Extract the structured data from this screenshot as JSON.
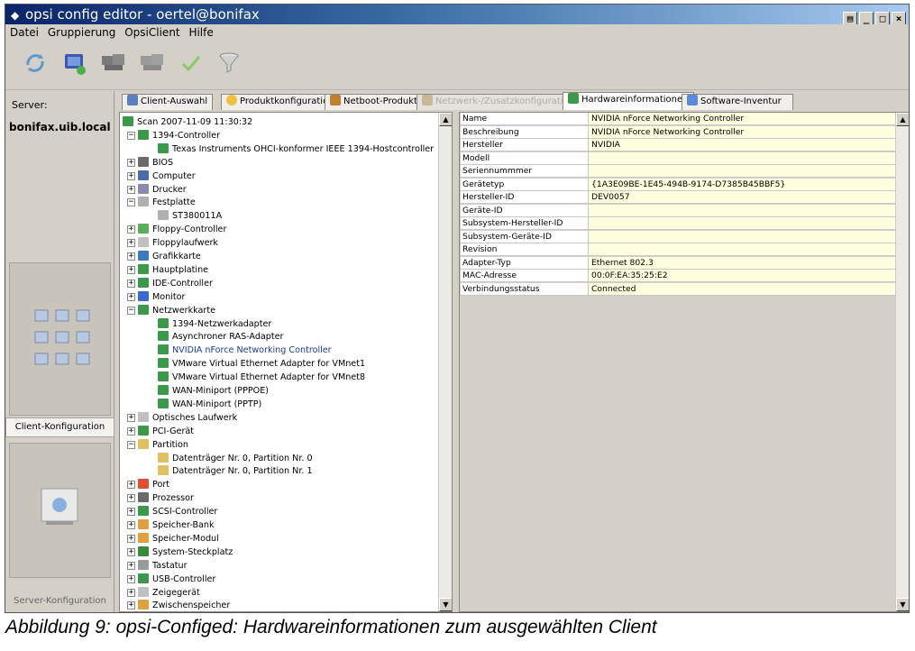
{
  "window": {
    "title": "opsi config editor - oertel@bonifax"
  },
  "menu": [
    "Datei",
    "Gruppierung",
    "OpsiClient",
    "Hilfe"
  ],
  "toolbar": [
    "reload-icon",
    "save-icon",
    "clients-icon",
    "clients-disabled-icon",
    "check-icon",
    "filter-icon"
  ],
  "left": {
    "server_label": "Server:",
    "server_name": "bonifax.uib.local",
    "client_tab": "Client-Konfiguration",
    "server_tab": "Server-Konfiguration"
  },
  "tabs": [
    {
      "label": "Client-Auswahl",
      "color": "#5a80c0"
    },
    {
      "label": "Produktkonfiguration",
      "color": "#f0c040"
    },
    {
      "label": "Netboot-Produkte",
      "color": "#c08030"
    },
    {
      "label": "Netzwerk-/Zusatzkonfiguration",
      "color": "#c8b898"
    },
    {
      "label": "Hardwareinformationen",
      "color": "#3a9a4a"
    },
    {
      "label": "Software-Inventur",
      "color": "#5a8ad8"
    }
  ],
  "tree": [
    {
      "label": "Scan 2007-11-09 11:30:32",
      "lvl": 0,
      "toggle": "",
      "color": "#3a9a4a"
    },
    {
      "label": "1394-Controller",
      "lvl": 1,
      "toggle": "−",
      "color": "#3a9a4a"
    },
    {
      "label": "Texas Instruments OHCI-konformer IEEE 1394-Hostcontroller",
      "lvl": 2,
      "toggle": "",
      "color": "#3a9a4a"
    },
    {
      "label": "BIOS",
      "lvl": 1,
      "toggle": "+",
      "color": "#6a6a6a"
    },
    {
      "label": "Computer",
      "lvl": 1,
      "toggle": "+",
      "color": "#4a6aa8"
    },
    {
      "label": "Drucker",
      "lvl": 1,
      "toggle": "+",
      "color": "#8a8ab0"
    },
    {
      "label": "Festplatte",
      "lvl": 1,
      "toggle": "−",
      "color": "#b0b0b0"
    },
    {
      "label": "ST380011A",
      "lvl": 2,
      "toggle": "",
      "color": "#b0b0b0"
    },
    {
      "label": "Floppy-Controller",
      "lvl": 1,
      "toggle": "+",
      "color": "#5ab05a"
    },
    {
      "label": "Floppylaufwerk",
      "lvl": 1,
      "toggle": "+",
      "color": "#c0c0c0"
    },
    {
      "label": "Grafikkarte",
      "lvl": 1,
      "toggle": "+",
      "color": "#3a7ac0"
    },
    {
      "label": "Hauptplatine",
      "lvl": 1,
      "toggle": "+",
      "color": "#3a9a4a"
    },
    {
      "label": "IDE-Controller",
      "lvl": 1,
      "toggle": "+",
      "color": "#3a9a4a"
    },
    {
      "label": "Monitor",
      "lvl": 1,
      "toggle": "+",
      "color": "#3a6ad0"
    },
    {
      "label": "Netzwerkkarte",
      "lvl": 1,
      "toggle": "−",
      "color": "#3a9a4a"
    },
    {
      "label": "1394-Netzwerkadapter",
      "lvl": 2,
      "toggle": "",
      "color": "#3a9a4a"
    },
    {
      "label": "Asynchroner RAS-Adapter",
      "lvl": 2,
      "toggle": "",
      "color": "#3a9a4a"
    },
    {
      "label": "NVIDIA nForce Networking Controller",
      "lvl": 2,
      "toggle": "",
      "color": "#3a9a4a",
      "selected": true
    },
    {
      "label": "VMware Virtual Ethernet Adapter for VMnet1",
      "lvl": 2,
      "toggle": "",
      "color": "#3a9a4a"
    },
    {
      "label": "VMware Virtual Ethernet Adapter for VMnet8",
      "lvl": 2,
      "toggle": "",
      "color": "#3a9a4a"
    },
    {
      "label": "WAN-Miniport (PPPOE)",
      "lvl": 2,
      "toggle": "",
      "color": "#3a9a4a"
    },
    {
      "label": "WAN-Miniport (PPTP)",
      "lvl": 2,
      "toggle": "",
      "color": "#3a9a4a"
    },
    {
      "label": "Optisches Laufwerk",
      "lvl": 1,
      "toggle": "+",
      "color": "#c0c0c0"
    },
    {
      "label": "PCI-Gerät",
      "lvl": 1,
      "toggle": "+",
      "color": "#3a9a4a"
    },
    {
      "label": "Partition",
      "lvl": 1,
      "toggle": "−",
      "color": "#e0c060"
    },
    {
      "label": "Datenträger Nr. 0, Partition Nr. 0",
      "lvl": 2,
      "toggle": "",
      "color": "#e0c060"
    },
    {
      "label": "Datenträger Nr. 0, Partition Nr. 1",
      "lvl": 2,
      "toggle": "",
      "color": "#e0c060"
    },
    {
      "label": "Port",
      "lvl": 1,
      "toggle": "+",
      "color": "#e05030"
    },
    {
      "label": "Prozessor",
      "lvl": 1,
      "toggle": "+",
      "color": "#6a6a6a"
    },
    {
      "label": "SCSI-Controller",
      "lvl": 1,
      "toggle": "+",
      "color": "#3a9a4a"
    },
    {
      "label": "Speicher-Bank",
      "lvl": 1,
      "toggle": "+",
      "color": "#e0a040"
    },
    {
      "label": "Speicher-Modul",
      "lvl": 1,
      "toggle": "+",
      "color": "#e0a040"
    },
    {
      "label": "System-Steckplatz",
      "lvl": 1,
      "toggle": "+",
      "color": "#3a8a3a"
    },
    {
      "label": "Tastatur",
      "lvl": 1,
      "toggle": "+",
      "color": "#9a9a9a"
    },
    {
      "label": "USB-Controller",
      "lvl": 1,
      "toggle": "+",
      "color": "#3a9a4a"
    },
    {
      "label": "Zeigegerät",
      "lvl": 1,
      "toggle": "+",
      "color": "#c0c0c0"
    },
    {
      "label": "Zwischenspeicher",
      "lvl": 1,
      "toggle": "+",
      "color": "#e0a040"
    }
  ],
  "details": [
    {
      "k": "Name",
      "v": "NVIDIA nForce Networking Controller"
    },
    {
      "k": "Beschreibung",
      "v": "NVIDIA nForce Networking Controller"
    },
    {
      "k": "Hersteller",
      "v": "NVIDIA"
    },
    {
      "k": "Modell",
      "v": ""
    },
    {
      "k": "Seriennummmer",
      "v": ""
    },
    {
      "k": "Gerätetyp",
      "v": "{1A3E09BE-1E45-494B-9174-D7385B45BBF5}"
    },
    {
      "k": "Hersteller-ID",
      "v": "DEV0057"
    },
    {
      "k": "Geräte-ID",
      "v": ""
    },
    {
      "k": "Subsystem-Hersteller-ID",
      "v": ""
    },
    {
      "k": "Subsystem-Geräte-ID",
      "v": ""
    },
    {
      "k": "Revision",
      "v": ""
    },
    {
      "k": "Adapter-Typ",
      "v": "Ethernet 802.3"
    },
    {
      "k": "MAC-Adresse",
      "v": "00:0F:EA:35:25:E2"
    },
    {
      "k": "Verbindungsstatus",
      "v": "Connected"
    }
  ],
  "caption": "Abbildung 9: opsi-Configed: Hardwareinformationen zum ausgewählten Client"
}
